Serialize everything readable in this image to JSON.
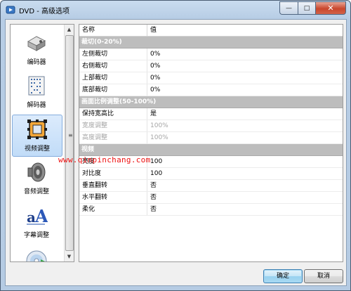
{
  "window": {
    "title": "DVD - 高级选项",
    "minimize_glyph": "—",
    "maximize_glyph": "□",
    "close_glyph": "✕"
  },
  "sidebar": {
    "items": [
      {
        "label": "编码器",
        "icon": "encoder-icon"
      },
      {
        "label": "解码器",
        "icon": "decoder-icon"
      },
      {
        "label": "视频调整",
        "icon": "video-adjust-icon",
        "selected": true
      },
      {
        "label": "音频调整",
        "icon": "audio-speaker-icon"
      },
      {
        "label": "字幕调整",
        "icon": "subtitle-icon"
      },
      {
        "label": "",
        "icon": "disc-icon"
      }
    ],
    "scroll_up": "▲",
    "scroll_down": "▼",
    "grip": "≡"
  },
  "table": {
    "headers": {
      "name": "名称",
      "value": "值"
    },
    "rows": [
      {
        "type": "group",
        "name": "裁切(0-20%)"
      },
      {
        "name": "左侧裁切",
        "value": "0%"
      },
      {
        "name": "右侧裁切",
        "value": "0%"
      },
      {
        "name": "上部裁切",
        "value": "0%"
      },
      {
        "name": "底部裁切",
        "value": "0%"
      },
      {
        "type": "group",
        "name": "画面比例调整(50-100%)"
      },
      {
        "name": "保持宽高比",
        "value": "是"
      },
      {
        "name": "宽度调整",
        "value": "100%",
        "disabled": true
      },
      {
        "name": "高度调整",
        "value": "100%",
        "disabled": true
      },
      {
        "type": "group",
        "name": "视频"
      },
      {
        "name": "亮度",
        "value": "100"
      },
      {
        "name": "对比度",
        "value": "100"
      },
      {
        "name": "垂直翻转",
        "value": "否"
      },
      {
        "name": "水平翻转",
        "value": "否"
      },
      {
        "name": "柔化",
        "value": "否"
      }
    ]
  },
  "watermark": "www.qinpinchang.com",
  "buttons": {
    "ok": "确定",
    "cancel": "取消"
  },
  "colors": {
    "watermark": "#ee1111",
    "group_header": "#bdbdbd",
    "selection": "#c1dcf8"
  }
}
